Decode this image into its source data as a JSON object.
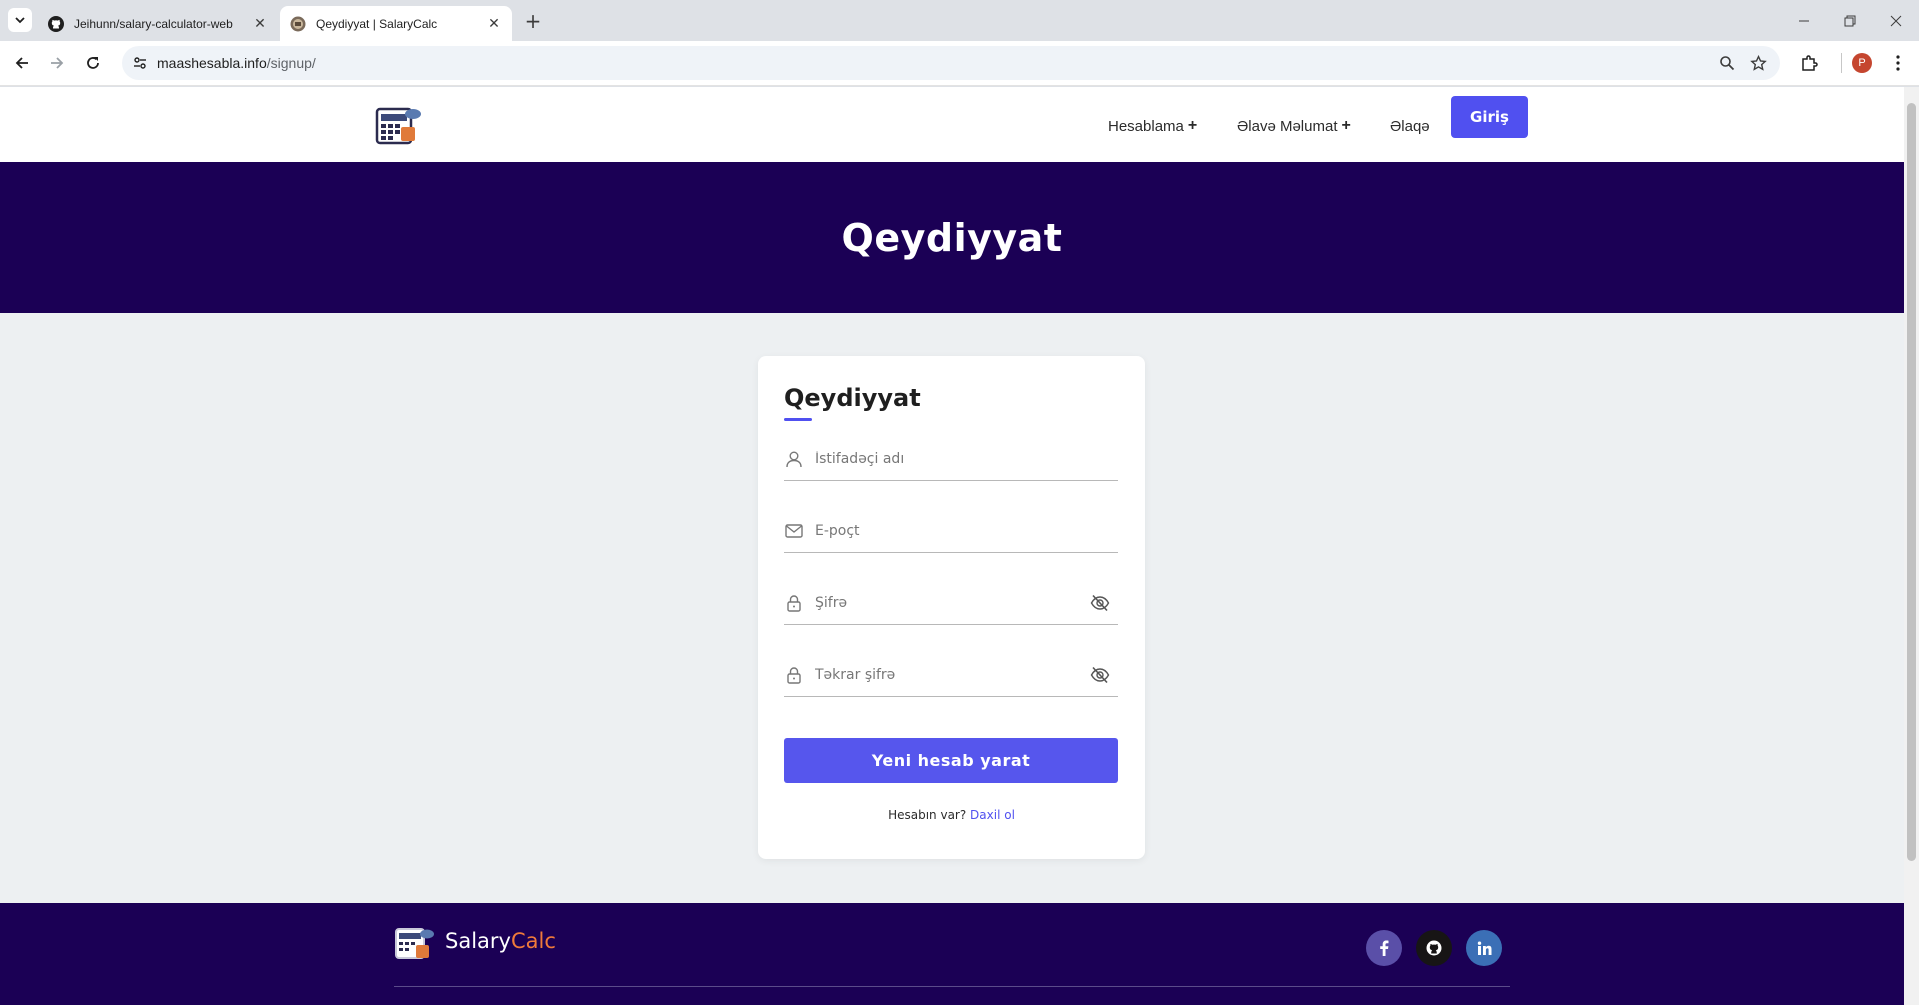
{
  "browser": {
    "tabs": [
      {
        "title": "Jeihunn/salary-calculator-web",
        "active": false,
        "icon": "github-icon"
      },
      {
        "title": "Qeydiyyat | SalaryCalc",
        "active": true,
        "icon": "salarycalc-favicon"
      }
    ],
    "url_host": "maashesabla.info",
    "url_path": "/signup/",
    "profile_initial": "P"
  },
  "header": {
    "menu": [
      {
        "label": "Hesablama",
        "has_submenu": true
      },
      {
        "label": "Əlavə Məlumat",
        "has_submenu": true
      },
      {
        "label": "Əlaqə",
        "has_submenu": false
      }
    ],
    "submenu_indicator": "+",
    "login_label": "Giriş"
  },
  "hero": {
    "title": "Qeydiyyat"
  },
  "form": {
    "title": "Qeydiyyat",
    "username_placeholder": "İstifadəçi adı",
    "email_placeholder": "E-poçt",
    "password_placeholder": "Şifrə",
    "password_repeat_placeholder": "Təkrar şifrə",
    "submit_label": "Yeni hesab yarat",
    "have_account_text": "Hesabın var?",
    "login_link": "Daxil ol"
  },
  "footer": {
    "brand_main": "Salary",
    "brand_accent": "Calc",
    "social": [
      {
        "name": "facebook-icon",
        "color": "#3b5998"
      },
      {
        "name": "github-icon",
        "color": "#171515"
      },
      {
        "name": "linkedin-icon",
        "color": "#3b6fb6"
      }
    ]
  },
  "colors": {
    "accent": "#5050f0",
    "hero_bg": "#1b0055",
    "brand_orange": "#f07a3a"
  }
}
